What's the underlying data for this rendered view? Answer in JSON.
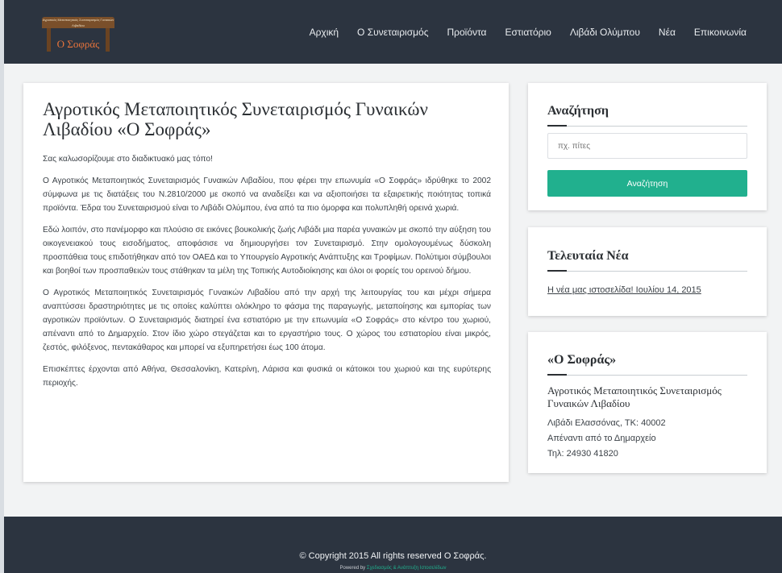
{
  "header": {
    "logo": {
      "board_text": "Αγροτικός Μεταποιητικός Συνεταιρισμός Γυναικών Λιβαδίου",
      "name": "Ο Σοφράς"
    },
    "nav": [
      "Αρχική",
      "Ο Συνεταιρισμός",
      "Προϊόντα",
      "Εστιατόριο",
      "Λιβάδι Ολύμπου",
      "Νέα",
      "Επικοινωνία"
    ]
  },
  "main": {
    "title": "Αγροτικός Μεταποιητικός Συνεταιρισμός Γυναικών Λιβαδίου «Ο Σοφράς»",
    "paragraphs": [
      "Σας καλωσορίζουμε στο διαδικτυακό μας τόπο!",
      "Ο Αγροτικός Μεταποιητικός Συνεταιρισμός Γυναικών Λιβαδίου, που φέρει την επωνυμία «Ο Σοφράς» ιδρύθηκε το 2002 σύμφωνα με τις διατάξεις του Ν.2810/2000 με σκοπό να αναδείξει και να αξιοποιήσει τα εξαιρετικής ποιότητας τοπικά προϊόντα. Έδρα του Συνεταιρισμού είναι το Λιβάδι Ολύμπου, ένα από τα πιο όμορφα και πολυπληθή ορεινά χωριά.",
      "Εδώ λοιπόν, στο πανέμορφο και πλούσιο σε εικόνες βουκολικής ζωής Λιβάδι μια παρέα γυναικών με σκοπό την αύξηση του οικογενειακού τους εισοδήματος, αποφάσισε να δημιουργήσει τον Συνεταιρισμό. Στην ομολογουμένως δύσκολη προσπάθεια τους επιδοτήθηκαν από τον ΟΑΕΔ και το Υπουργείο Αγροτικής Ανάπτυξης και Τροφίμων. Πολύτιμοι σύμβουλοι και βοηθοί των προσπαθειών τους στάθηκαν τα μέλη της Τοπικής Αυτοδιοίκησης και όλοι οι φορείς του ορεινού δήμου.",
      "Ο Αγροτικός Μεταποιητικός Συνεταιρισμός Γυναικών Λιβαδίου από την αρχή της λειτουργίας του και μέχρι σήμερα αναπτύσσει δραστηριότητες με τις οποίες καλύπτει ολόκληρο το φάσμα της παραγωγής, μεταποίησης και εμπορίας των αγροτικών προϊόντων. Ο Συνεταιρισμός διατηρεί ένα εστιατόριο με την επωνυμία «Ο Σοφράς» στο κέντρο του χωριού, απέναντι από το Δημαρχείο. Στον ίδιο χώρο στεγάζεται και το εργαστήριο τους. Ο χώρος του εστιατορίου είναι μικρός, ζεστός, φιλόξενος, πεντακάθαρος και μπορεί να εξυπηρετήσει έως 100 άτομα.",
      "Επισκέπτες έρχονται από Αθήνα, Θεσσαλονίκη, Κατερίνη, Λάρισα και φυσικά οι κάτοικοι του χωριού και της ευρύτερης περιοχής."
    ]
  },
  "sidebar": {
    "search": {
      "title": "Αναζήτηση",
      "placeholder": "πχ. πίτες",
      "button": "Αναζήτηση"
    },
    "news": {
      "title": "Τελευταία Νέα",
      "item": "Η νέα μας ιστοσελίδα! Ιουλίου 14, 2015"
    },
    "contact": {
      "title": "«Ο Σοφράς»",
      "org": "Αγροτικός Μεταποιητικός Συνεταιρισμός Γυναικών Λιβαδίου",
      "address": "Λιβάδι Ελασσόνας, ΤΚ: 40002",
      "location": "Απέναντι από το Δημαρχείο",
      "phone": "Τηλ: 24930 41820"
    }
  },
  "footer": {
    "copyright": "© Copyright 2015 All rights reserved Ο Σοφράς.",
    "powered_prefix": "Powered by",
    "powered_link": "Σχεδιασμός & Ανάπτυξη Ιστοσελίδων"
  },
  "colors": {
    "header_bg": "#2c3440",
    "accent": "#21b08e",
    "page_bg": "#f2f3f4"
  }
}
